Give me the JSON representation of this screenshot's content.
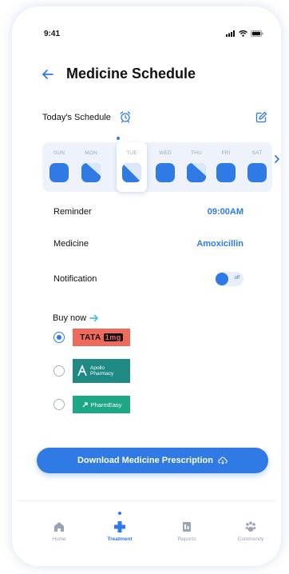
{
  "status_bar": {
    "time": "9:41"
  },
  "header": {
    "title": "Medicine Schedule"
  },
  "schedule": {
    "label": "Today's Schedule",
    "days": [
      {
        "name": "SUN",
        "fill": "full"
      },
      {
        "name": "MON",
        "fill": "partial"
      },
      {
        "name": "TUE",
        "fill": "half",
        "active": true
      },
      {
        "name": "WED",
        "fill": "full"
      },
      {
        "name": "THU",
        "fill": "partial"
      },
      {
        "name": "FRI",
        "fill": "full"
      },
      {
        "name": "SAT",
        "fill": "full"
      }
    ]
  },
  "details": {
    "reminder_label": "Reminder",
    "reminder_value": "09:00AM",
    "medicine_label": "Medicine",
    "medicine_value": "Amoxicillin",
    "notification_label": "Notification",
    "notification_state": "off"
  },
  "buy": {
    "label": "Buy now",
    "pharmacies": [
      {
        "name": "TATA 1mg",
        "brand_a": "TATA",
        "brand_b": "1mg",
        "selected": true
      },
      {
        "name": "Apollo Pharmacy",
        "brand_a": "Apollo",
        "brand_b": "Pharmacy",
        "selected": false
      },
      {
        "name": "PharmEasy",
        "brand_a": "PharmEasy",
        "selected": false
      }
    ]
  },
  "download_button": {
    "label": "Download Medicine Prescription"
  },
  "nav": {
    "items": [
      {
        "label": "Home",
        "icon": "home-icon"
      },
      {
        "label": "Treatment",
        "icon": "plus-icon",
        "active": true
      },
      {
        "label": "Reports",
        "icon": "reports-icon"
      },
      {
        "label": "Community",
        "icon": "paw-icon"
      }
    ]
  },
  "colors": {
    "accent": "#2f7ae5",
    "day_strip": "#eef3fb",
    "tata": "#ef6a5a",
    "apollo": "#1f8a83",
    "pharmeasy": "#1ea784"
  }
}
